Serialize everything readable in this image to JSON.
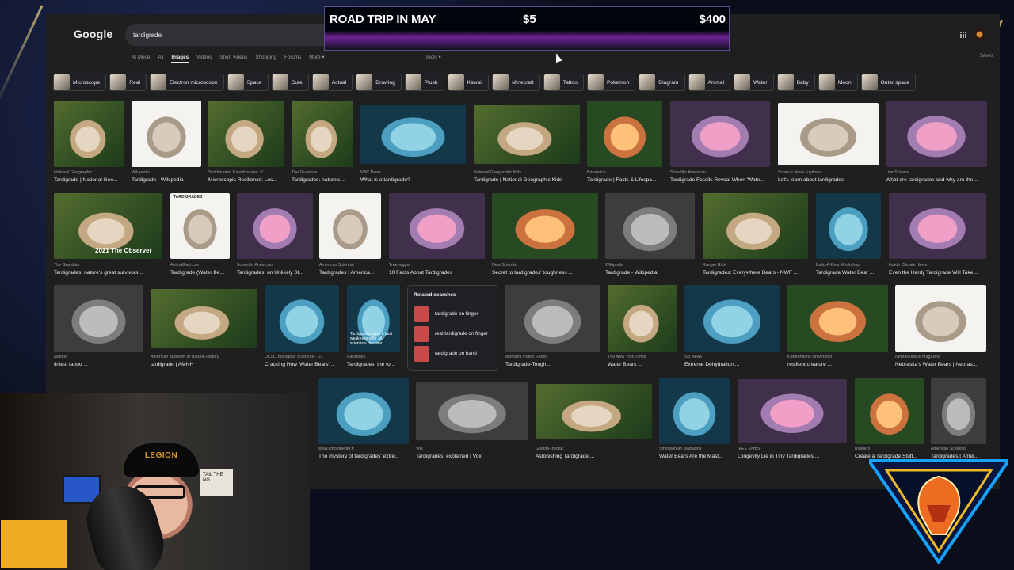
{
  "overlay": {
    "title": "ROAD TRIP IN MAY",
    "amount_current": "$5",
    "amount_goal": "$400"
  },
  "google": {
    "logo": "Google",
    "query": "tardigrade",
    "saves": "Saves",
    "tools": "Tools ▾"
  },
  "tabs": [
    "AI Mode",
    "All",
    "Images",
    "Videos",
    "Short videos",
    "Shopping",
    "Forums",
    "More ▾"
  ],
  "chips": [
    "Microscope",
    "Real",
    "Electron microscope",
    "Space",
    "Cute",
    "Actual",
    "Drawing",
    "Plush",
    "Kawaii",
    "Minecraft",
    "Tattoo",
    "Pokemon",
    "Diagram",
    "Animal",
    "Water",
    "Baby",
    "Moon",
    "Outer space"
  ],
  "results": [
    {
      "source": "National Geographic",
      "title": "Tardigrade | National Geo..."
    },
    {
      "source": "Wikipedia",
      "title": "Tardigrade - Wikipedia"
    },
    {
      "source": "Smithsonian Kaleidoscope: P...",
      "title": "Microscopic Resilience: Les..."
    },
    {
      "source": "The Guardian",
      "title": "Tardigrades: nature's ..."
    },
    {
      "source": "NBC News",
      "title": "What is a tardigrade?"
    },
    {
      "source": "National Geographic Kids",
      "title": "Tardigrade | National Geographic Kids"
    },
    {
      "source": "Britannica",
      "title": "Tardigrade | Facts & Lifespa..."
    },
    {
      "source": "Scientific American",
      "title": "Tardigrade Fossils Reveal When 'Wate..."
    },
    {
      "source": "Science News Explores",
      "title": "Let's learn about tardigrades"
    },
    {
      "source": "Live Science",
      "title": "What are tardigrades and why are the..."
    },
    {
      "source": "The Guardian",
      "title": "Tardigrades: nature's great survivors ..."
    },
    {
      "source": "AnimalFact.com",
      "title": "Tardigrade (Water Be..."
    },
    {
      "source": "Scientific American",
      "title": "Tardigrades, an Unlikely St..."
    },
    {
      "source": "American Scientist",
      "title": "Tardigrades | America..."
    },
    {
      "source": "Treehugger",
      "title": "10 Facts About Tardigrades"
    },
    {
      "source": "New Scientist",
      "title": "Secret to tardigrades' toughness ..."
    },
    {
      "source": "Wikipedia",
      "title": "Tardigrade - Wikipedia"
    },
    {
      "source": "Ranger Rick",
      "title": "Tardigrades: Everywhere Bears - NWF ..."
    },
    {
      "source": "Build-A-Bear Workshop",
      "title": "Tardigrade Water Bear ..."
    },
    {
      "source": "Inside Climate News",
      "title": "Even the Hardy Tardigrade Will Take ..."
    },
    {
      "source": "Nature",
      "title": "tiniest tattoo ..."
    },
    {
      "source": "American Museum of Natural History",
      "title": "tardigrade | AMNH"
    },
    {
      "source": "UCSD Biological Sciences - U...",
      "title": "Cracking How 'Water Bears'..."
    },
    {
      "source": "Facebook",
      "title": "Tardigrades, the to..."
    },
    {
      "source": "Montana Public Radio",
      "title": "Tardigrade-Tough ..."
    },
    {
      "source": "The New York Times",
      "title": "Water Bears ..."
    },
    {
      "source": "Sci.News",
      "title": "Extreme Dehydration ..."
    },
    {
      "source": "Københavns Universitet",
      "title": "resilient creature ..."
    },
    {
      "source": "Nebraskaland Magazine",
      "title": "Nebraska's Water Bears | Nebras..."
    },
    {
      "source": "www.smootpetter.fr",
      "title": "The mystery of tardigrades' extre..."
    },
    {
      "source": "Vox",
      "title": "Tardigrades, explained | Vox"
    },
    {
      "source": "Goethe-Institut",
      "title": "Astonishing Tardigrade ..."
    },
    {
      "source": "Smithsonian Magazine",
      "title": "Water Bears Are the Mast..."
    },
    {
      "source": "IEEE EMBS",
      "title": "Longevity Lie in Tiny Tardigrades ..."
    },
    {
      "source": "Builders",
      "title": "Create a Tardigrade Stuff..."
    },
    {
      "source": "American Scientist",
      "title": "Tardigrades | Amer..."
    }
  ],
  "related_searches": {
    "title": "Related searches",
    "items": [
      "tardigrade on finger",
      "real tardigrade on finger",
      "tardigrade on hand"
    ]
  },
  "image_labels": {
    "observer": "2021 The Observer",
    "tardigrades_card": "TARDIGRADES",
    "weakness": "Tardigrades have a fatal weakness after all, scientists discover"
  },
  "webcam": {
    "cap_text": "LEGION",
    "shelf_text": "TAIL THE NG"
  }
}
